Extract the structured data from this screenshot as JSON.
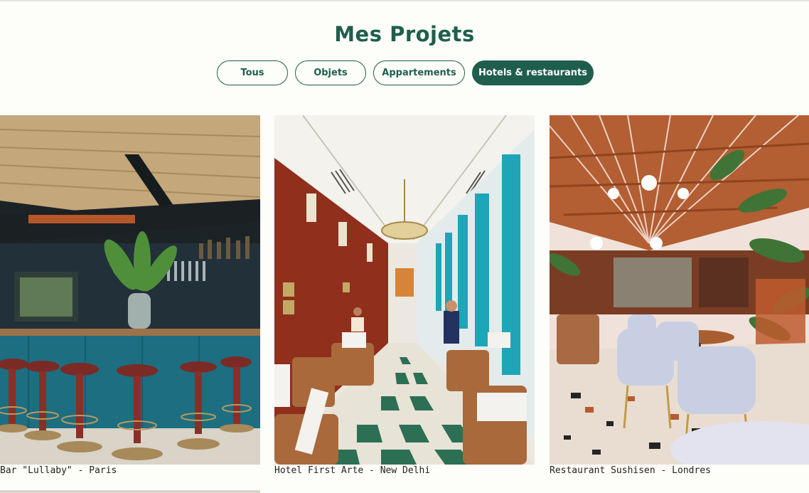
{
  "page": {
    "title": "Mes Projets"
  },
  "filters": [
    {
      "label": "Tous",
      "active": false
    },
    {
      "label": "Objets",
      "active": false
    },
    {
      "label": "Appartements",
      "active": false
    },
    {
      "label": "Hotels & restaurants",
      "active": true
    }
  ],
  "projects": [
    {
      "caption": "Bar \"Lullaby\" - Paris",
      "image": "bar-interior-photo"
    },
    {
      "caption": "Hotel First Arte - New Delhi",
      "image": "hotel-dining-hall-photo"
    },
    {
      "caption": "Restaurant Sushisen - Londres",
      "image": "restaurant-interior-photo"
    }
  ],
  "colors": {
    "brand": "#1f5e4d",
    "background": "#fdfdf9"
  }
}
